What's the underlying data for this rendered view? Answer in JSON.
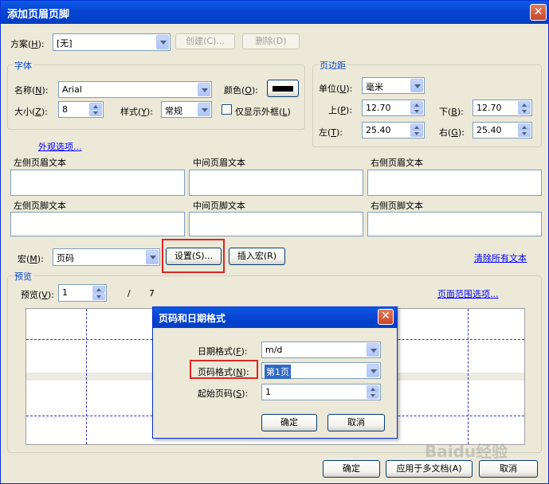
{
  "window": {
    "title": "添加页眉页脚",
    "close": "✕"
  },
  "scheme": {
    "label": "方案(",
    "key": "H",
    "label_end": "):",
    "value": "[无]",
    "create_label": "创建(C)...",
    "delete_label": "删除(D)"
  },
  "font_group": {
    "title": "字体",
    "name_label": "名称(",
    "name_key": "N",
    "name_end": "):",
    "name_value": "Arial",
    "color_label": "颜色(",
    "color_key": "O",
    "color_end": "):",
    "color_value": "#000000",
    "size_label": "大小(",
    "size_key": "Z",
    "size_end": "):",
    "size_value": "8",
    "style_label": "样式(",
    "style_key": "Y",
    "style_end": "):",
    "style_value": "常规",
    "outline_label": "仅显示外框(",
    "outline_key": "L",
    "outline_end": ")"
  },
  "margin_group": {
    "title": "页边距",
    "unit_label": "单位(",
    "unit_key": "U",
    "unit_end": "):",
    "unit_value": "毫米",
    "top_label": "上(",
    "top_key": "P",
    "top_end": "):",
    "top_value": "12.70",
    "bottom_label": "下(",
    "bottom_key": "B",
    "bottom_end": "):",
    "bottom_value": "12.70",
    "left_label": "左(",
    "left_key": "T",
    "left_end": "):",
    "left_value": "25.40",
    "right_label": "右(",
    "right_key": "G",
    "right_end": "):",
    "right_value": "25.40"
  },
  "appearance_link": "外观选项...",
  "text_boxes": {
    "left_header": "左侧页眉文本",
    "center_header": "中间页眉文本",
    "right_header": "右侧页眉文本",
    "left_footer": "左侧页脚文本",
    "center_footer": "中间页脚文本",
    "right_footer": "右侧页脚文本"
  },
  "macro": {
    "label": "宏(",
    "key": "M",
    "label_end": "):",
    "value": "页码",
    "settings_label": "设置(S)...",
    "insert_label": "插入宏(R)",
    "clear_link": "清除所有文本"
  },
  "preview": {
    "title": "预览",
    "label": "预览(",
    "key": "V",
    "label_end": "):",
    "page_value": "1",
    "slash": "/",
    "total": "7",
    "range_link": "页面范围选项..."
  },
  "buttons": {
    "ok": "确定",
    "apply_multi": "应用于多文档(A)",
    "cancel": "取消"
  },
  "dialog": {
    "title": "页码和日期格式",
    "close": "✕",
    "date_label": "日期格式(",
    "date_key": "F",
    "date_end": "):",
    "date_value": "m/d",
    "page_label": "页码格式(",
    "page_key": "N",
    "page_end": "):",
    "page_value": "第1页",
    "start_label": "起始页码(",
    "start_key": "S",
    "start_end": "):",
    "start_value": "1",
    "ok": "确定",
    "cancel": "取消"
  },
  "watermark": "Baidu经验"
}
